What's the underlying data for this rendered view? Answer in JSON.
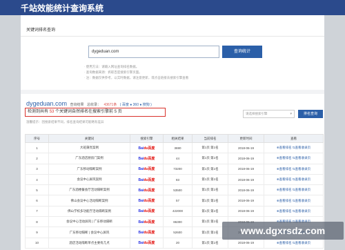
{
  "app": {
    "title": "千站效能统计查询系统"
  },
  "section": {
    "title": "关键词排名查询"
  },
  "search": {
    "value": "dygeduan.com",
    "button_label": "查询统计"
  },
  "hints": [
    "·  使用方法：请输入网址查询排名数据。",
    "·  查询数据来源：抓取百度搜索引擎页面。",
    "·  注：数据仅供参考，以实时数据，请注意更新，或点击链接去搜索引擎查看"
  ],
  "domain_info": {
    "domain": "dygeduan.com",
    "label_query": "查询结果",
    "label_total": "总收录：",
    "total": "43671条",
    "links": "( 百度 ● 360 ● 搜狗 )"
  },
  "result": {
    "prefix": "检测到共有",
    "count": "53",
    "suffix": "个关键词自然排名在搜索引擎前 5 页"
  },
  "warning": "温馨提示：因搜索结果不同，排名查询结果可能略有差异",
  "engine_select": {
    "placeholder": "请选择搜索引擎"
  },
  "rank_button_label": "排名查询",
  "table": {
    "headers": [
      "序号",
      "关键词",
      "搜索引擎",
      "相关结果",
      "当前排名",
      "更新时间",
      "查看"
    ],
    "rows": [
      {
        "no": "1",
        "keyword": "大班蒲亮案例",
        "results": "3690",
        "rank": "第1页 第1名",
        "date": "2018-06-19"
      },
      {
        "no": "2",
        "keyword": "广东酒店厨房门案例",
        "results": "44",
        "rank": "第1页 第1名",
        "date": "2018-06-19"
      },
      {
        "no": "3",
        "keyword": "广东移动隔断案例",
        "results": "73200",
        "rank": "第1页 第1名",
        "date": "2018-06-19"
      },
      {
        "no": "4",
        "keyword": "会议中心屏风案例",
        "results": "83",
        "rank": "第1页 第1名",
        "date": "2018-06-19"
      },
      {
        "no": "5",
        "keyword": "广东酒楼餐会厅活动隔断案例",
        "results": "53500",
        "rank": "第1页 第1名",
        "date": "2018-06-19"
      },
      {
        "no": "6",
        "keyword": "佛山会议中心活动隔断案例",
        "results": "57",
        "rank": "第1页 第1名",
        "date": "2018-06-19"
      },
      {
        "no": "7",
        "keyword": "佛山学校多功能厅活动隔断案例",
        "results": "422000",
        "rank": "第1页 第1名",
        "date": "2018-06-19"
      },
      {
        "no": "8",
        "keyword": "会议中心活动屏风 | 广东移动隔断",
        "results": "86300",
        "rank": "第1页 第1名",
        "date": "2018-06-19"
      },
      {
        "no": "9",
        "keyword": "广东移动隔断 | 会议中心屏风",
        "results": "52600",
        "rank": "第1页 第1名",
        "date": "2018-06-19"
      },
      {
        "no": "10",
        "keyword": "酒店活动隔断单点主要有几点",
        "results": "20",
        "rank": "第1页 第1名",
        "date": "2018-06-19"
      }
    ],
    "engine_label_a": "Bai",
    "engine_label_b": "du百度",
    "view_rank": "⊕查看排名",
    "view_page": "⇆查看收录页"
  },
  "watermark": "www.dgxrsdz.com",
  "colors": {
    "header": "#2b4a8c",
    "accent": "#2b5fa8",
    "highlight": "#d9302a"
  }
}
